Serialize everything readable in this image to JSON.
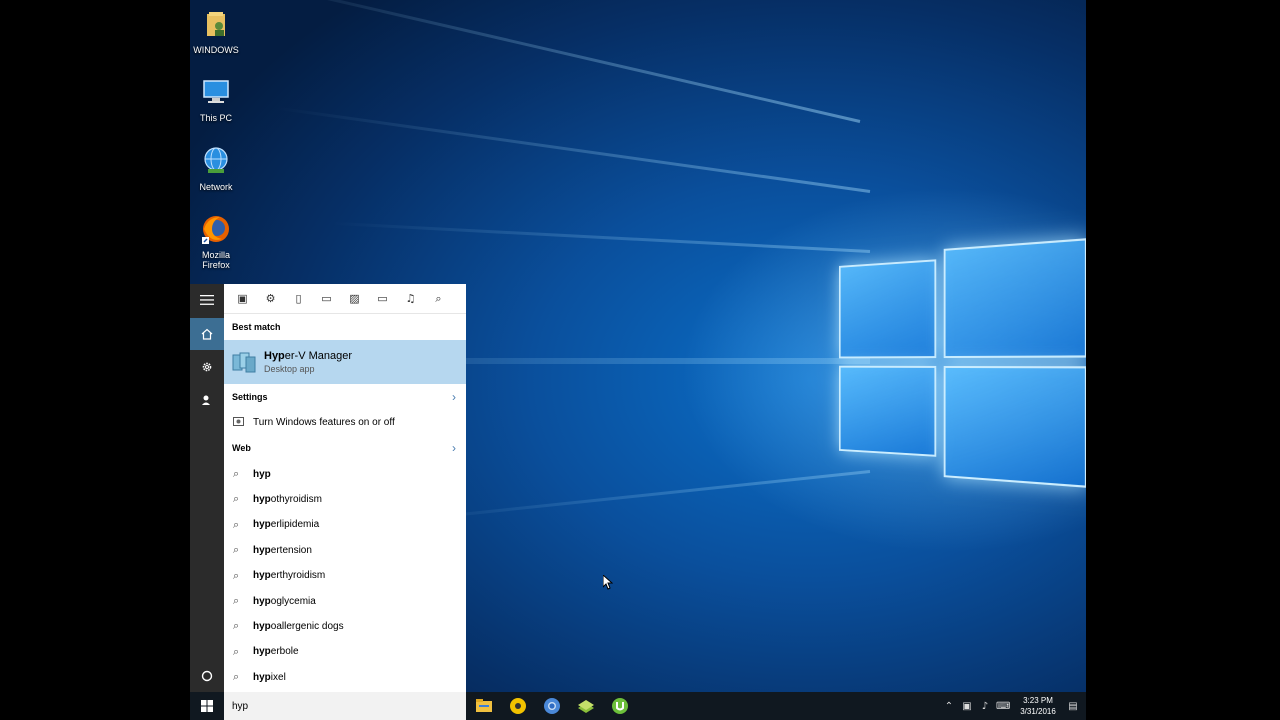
{
  "desktop": {
    "icons": [
      {
        "label": "WINDOWS",
        "icon": "user-folder-icon"
      },
      {
        "label": "This PC",
        "icon": "computer-icon"
      },
      {
        "label": "Network",
        "icon": "network-globe-icon"
      },
      {
        "label": "Mozilla Firefox",
        "icon": "firefox-icon"
      }
    ]
  },
  "start_menu": {
    "rail": {
      "icons": [
        "hamburger-menu-icon",
        "home-icon",
        "settings-icon",
        "feedback-icon",
        "cortana-circle-icon"
      ]
    },
    "filters": {
      "icons": [
        "apps-icon",
        "settings-icon",
        "documents-icon",
        "folders-icon",
        "photos-icon",
        "videos-icon",
        "music-icon",
        "web-search-icon"
      ]
    },
    "best_match": {
      "header": "Best match",
      "title": "Hyper-V Manager",
      "title_highlight": "Hyp",
      "title_rest": "er-V Manager",
      "subtitle": "Desktop app",
      "icon": "hyper-v-icon"
    },
    "settings": {
      "header": "Settings",
      "items": [
        {
          "label": "Turn Windows features on or off",
          "icon": "windows-features-icon"
        }
      ]
    },
    "web": {
      "header": "Web",
      "suggestions": [
        {
          "bold": "hyp",
          "rest": ""
        },
        {
          "bold": "hyp",
          "rest": "othyroidism"
        },
        {
          "bold": "hyp",
          "rest": "erlipidemia"
        },
        {
          "bold": "hyp",
          "rest": "ertension"
        },
        {
          "bold": "hyp",
          "rest": "erthyroidism"
        },
        {
          "bold": "hyp",
          "rest": "oglycemia"
        },
        {
          "bold": "hyp",
          "rest": "oallergenic dogs"
        },
        {
          "bold": "hyp",
          "rest": "erbole"
        },
        {
          "bold": "hyp",
          "rest": "ixel"
        }
      ]
    }
  },
  "taskbar": {
    "search_value": "hyp",
    "pinned": [
      "file-explorer-icon",
      "disc-burner-icon",
      "chrome-icon",
      "book-app-icon",
      "utorrent-icon"
    ],
    "tray_icons": [
      "chevron-up-icon",
      "network-icon",
      "volume-icon",
      "keyboard-icon",
      "action-center-icon"
    ],
    "time": "3:23 PM",
    "date": "3/31/2016"
  },
  "colors": {
    "accent": "#3c6e93",
    "best_match_bg": "#b6d7ef",
    "taskbar": "#101820",
    "rail": "#2b2b2b"
  }
}
